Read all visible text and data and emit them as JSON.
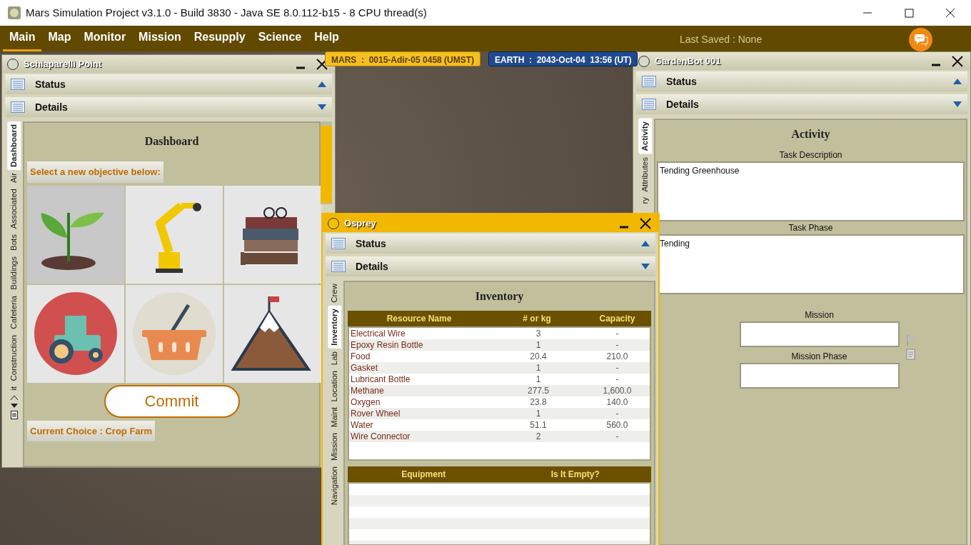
{
  "window": {
    "title": "Mars Simulation Project v3.1.0 - Build 3830 - Java SE 8.0.112-b15 - 8 CPU thread(s)"
  },
  "menu": [
    {
      "label": "Main",
      "selected": true
    },
    {
      "label": "Map",
      "selected": false
    },
    {
      "label": "Monitor",
      "selected": false
    },
    {
      "label": "Mission",
      "selected": false
    },
    {
      "label": "Resupply",
      "selected": false
    },
    {
      "label": "Science",
      "selected": false
    },
    {
      "label": "Help",
      "selected": false
    }
  ],
  "last_saved": "Last Saved : None",
  "clocks": [
    {
      "kind": "mars",
      "text": "MARS  :  0015-Adir-05 0458 (UMST)"
    },
    {
      "kind": "earth",
      "text": "EARTH  :  2043-Oct-04  13:56 (UT)"
    }
  ],
  "settlement_window": {
    "title": "Schiaparelli Point",
    "active": false,
    "sections": [
      {
        "label": "Status",
        "expanded": true
      },
      {
        "label": "Details",
        "expanded": false
      }
    ],
    "side_tabs": [
      {
        "label": "Dashboard",
        "selected": true
      },
      {
        "label": "Air",
        "selected": false
      },
      {
        "label": "Associated",
        "selected": false
      },
      {
        "label": "Bots",
        "selected": false
      },
      {
        "label": "Buildings",
        "selected": false
      },
      {
        "label": "Cafeteria",
        "selected": false
      },
      {
        "label": "Construction",
        "selected": false
      },
      {
        "label": "it",
        "selected": false
      }
    ],
    "panel_title": "Dashboard",
    "prompt": "Select a new objective below:",
    "objectives": [
      {
        "kind": "plant",
        "selected": true
      },
      {
        "kind": "robot",
        "selected": false
      },
      {
        "kind": "books",
        "selected": false
      },
      {
        "kind": "tractor",
        "selected": false
      },
      {
        "kind": "basket",
        "selected": false
      },
      {
        "kind": "mountain",
        "selected": false
      }
    ],
    "commit": "Commit",
    "current_choice": "Current Choice : Crop Farm"
  },
  "vehicle_window": {
    "title": "Osprey",
    "active": true,
    "sections": [
      {
        "label": "Status",
        "expanded": true
      },
      {
        "label": "Details",
        "expanded": false
      }
    ],
    "side_tabs": [
      {
        "label": "Crew",
        "selected": false
      },
      {
        "label": "Inventory",
        "selected": true
      },
      {
        "label": "Lab",
        "selected": false
      },
      {
        "label": "Location",
        "selected": false
      },
      {
        "label": "Maint",
        "selected": false
      },
      {
        "label": "Mission",
        "selected": false
      },
      {
        "label": "Navigation",
        "selected": false
      }
    ],
    "panel_title": "Inventory",
    "resources": {
      "columns": [
        "Resource Name",
        "# or kg",
        "Capacity"
      ],
      "rows": [
        [
          "Electrical Wire",
          "3",
          "-"
        ],
        [
          "Epoxy Resin Bottle",
          "1",
          "-"
        ],
        [
          "Food",
          "20.4",
          "210.0"
        ],
        [
          "Gasket",
          "1",
          "-"
        ],
        [
          "Lubricant Bottle",
          "1",
          "-"
        ],
        [
          "Methane",
          "277.5",
          "1,600.0"
        ],
        [
          "Oxygen",
          "23.8",
          "140.0"
        ],
        [
          "Rover Wheel",
          "1",
          "-"
        ],
        [
          "Water",
          "51.1",
          "560.0"
        ],
        [
          "Wire Connector",
          "2",
          "-"
        ]
      ]
    },
    "equipment": {
      "columns": [
        "Equipment",
        "Is It Empty?"
      ]
    }
  },
  "robot_window": {
    "title": "GardenBot 001",
    "active": false,
    "sections": [
      {
        "label": "Status",
        "expanded": true
      },
      {
        "label": "Details",
        "expanded": false
      }
    ],
    "side_tabs": [
      {
        "label": "Activity",
        "selected": true
      },
      {
        "label": "Attributes",
        "selected": false
      },
      {
        "label": "ry",
        "selected": false
      }
    ],
    "panel_title": "Activity",
    "task_description": {
      "label": "Task Description",
      "value": "Tending Greenhouse"
    },
    "task_phase": {
      "label": "Task Phase",
      "value": "Tending"
    },
    "mission": {
      "label": "Mission"
    },
    "mission_phase": {
      "label": "Mission Phase"
    }
  }
}
